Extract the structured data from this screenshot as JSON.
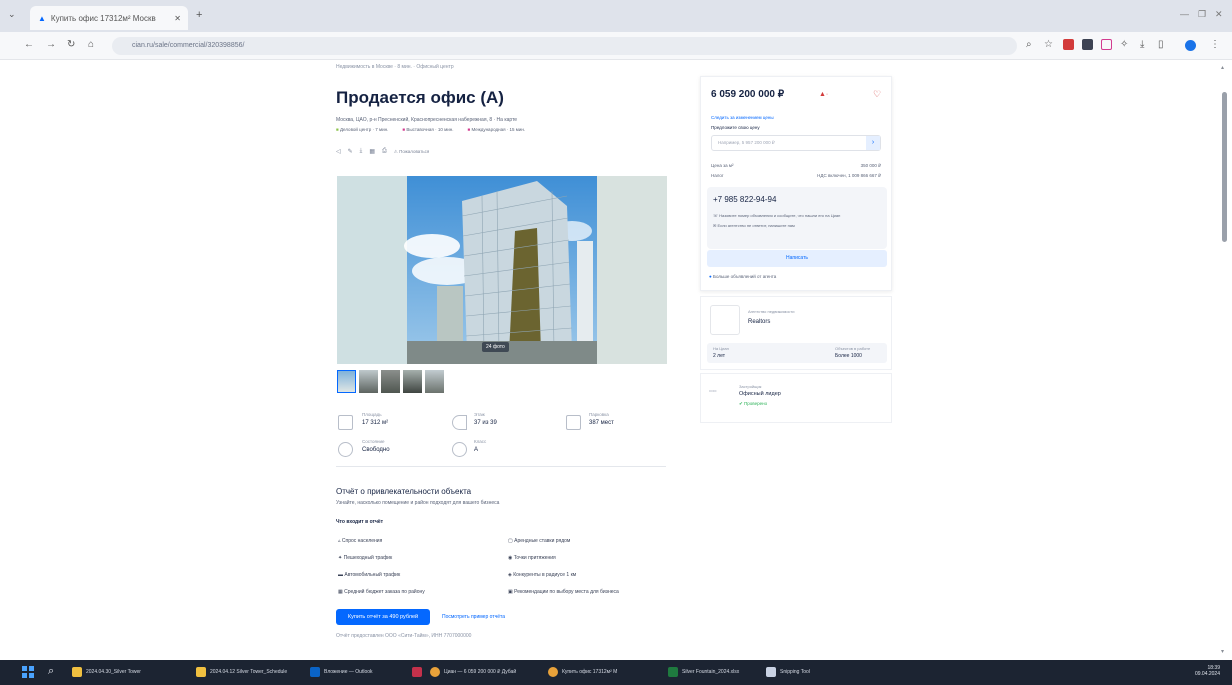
{
  "browser": {
    "tab_title": "Купить офис 17312м² Москв",
    "url": "cian.ru/sale/commercial/320398856/",
    "new_tab_label": "+"
  },
  "page": {
    "breadcrumb": "Недвижимость в Москве · 8 мин. · Офисный центр",
    "title": "Продается офис (А)",
    "address": "Москва, ЦАО, р-н Пресненский, Краснопресненская набережная, 8 · На карте",
    "metro": [
      "Деловой центр · 7 мин.",
      "Выставочная · 10 мин.",
      "Международная · 15 мин."
    ],
    "toolbar_actions": [
      "Пожаловаться"
    ],
    "photo_badge": "24 фото",
    "features": [
      {
        "label": "Площадь",
        "value": "17 312 м²"
      },
      {
        "label": "Этаж",
        "value": "37 из 39"
      },
      {
        "label": "Парковка",
        "value": "387 мест"
      },
      {
        "label": "Состояние",
        "value": "Свободно"
      },
      {
        "label": "Класс",
        "value": "А"
      }
    ],
    "report": {
      "title": "Отчёт о привлекательности объекта",
      "subtitle": "Узнайте, насколько помещение и район подходят для вашего бизнеса",
      "what_inside": "Что входит в отчёт",
      "items_left": [
        "Спрос населения",
        "Пешеходный трафик",
        "Автомобильный трафик",
        "Средний бюджет заказа по району"
      ],
      "items_right": [
        "Арендные ставки рядом",
        "Точки притяжения",
        "Конкуренты в радиусе 1 км",
        "Рекомендации по выбору места для бизнеса"
      ],
      "buy_button": "Купить отчёт за 490 рублей",
      "example_link": "Посмотреть пример отчёта",
      "footnote": "Отчёт предоставлен ООО «Сити-Тайм», ИНН 7707000000"
    }
  },
  "sidebar": {
    "price": "6 059 200 000 ₽",
    "price_link": "Следить за изменением цены",
    "offer_label": "Предложите свою цену",
    "offer_placeholder": "Например, 5 957 200 000 ₽",
    "rows": [
      {
        "label": "Цена за м²",
        "value": "350 000 ₽"
      },
      {
        "label": "Налог",
        "value": "НДС включен, 1 009 866 667 ₽"
      }
    ],
    "phone": "+7 985 822-94-94",
    "notes": [
      "Назовите номер объявления и сообщите, что нашли его на Циан",
      "Если агентство не ответит, напишите нам"
    ],
    "contact_button": "Написать",
    "agent_hint": "Больше объявлений от агента",
    "agency_label": "Агентство недвижимости",
    "agency_name": "Realtors",
    "agency_stats": [
      {
        "label": "На Циан",
        "value": "2 лет"
      },
      {
        "label": "Объектов в работе",
        "value": "Более 1000"
      }
    ],
    "builder_label": "Застройщик",
    "builder_name": "Офисный лидер",
    "builder_status": "Проверено"
  },
  "taskbar": {
    "clock": "18:39",
    "date": "09.04.2024",
    "apps": [
      "2024.04.30_Silver Tower",
      "2024.04.12 Silver Tower_Schedule",
      "Вложение — Outlook",
      "Циан — 6 059 200 000 ₽ Дубай",
      "Купить офис 17312м² М",
      "Silver Fountain_2024.xlsx",
      "Snipping Tool"
    ]
  }
}
